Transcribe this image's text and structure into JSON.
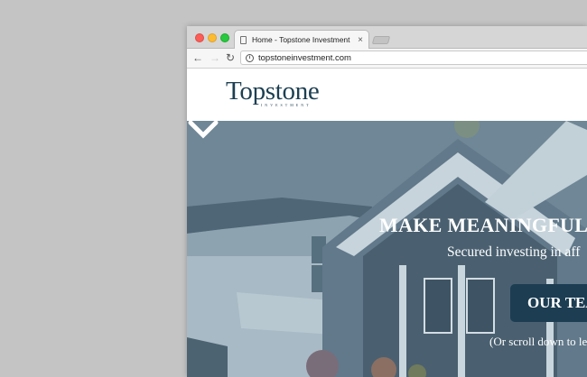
{
  "browser": {
    "tab": {
      "title": "Home - Topstone Investment",
      "close": "×"
    },
    "address": {
      "url": "topstoneinvestment.com"
    },
    "nav": {
      "back": "←",
      "forward": "→",
      "reload": "↻"
    }
  },
  "site": {
    "logo": {
      "name": "Topstone",
      "tagline": "INVESTMENT"
    },
    "hero": {
      "headline": "MAKE MEANINGFUL",
      "subheadline": "Secured investing in aff",
      "button_label": "OUR TEA",
      "scroll_hint": "(Or scroll down to le"
    }
  },
  "colors": {
    "brand": "#1c3f52",
    "button": "#1c3d52",
    "hero_overlay": "#5b7382"
  }
}
